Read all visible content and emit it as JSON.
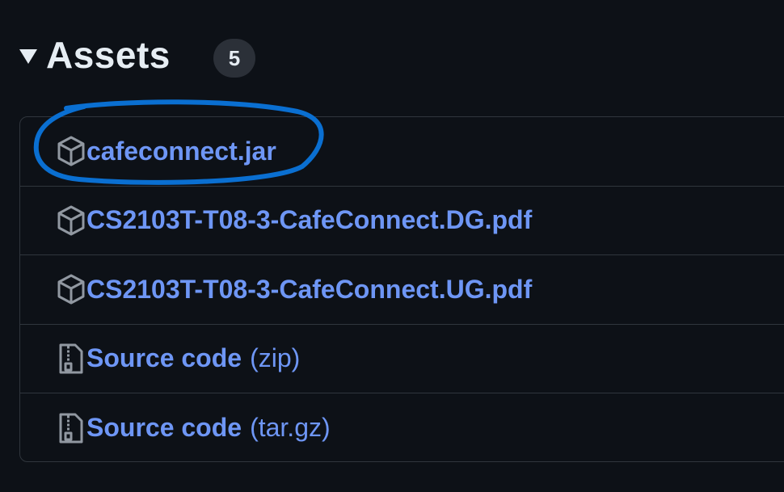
{
  "assets": {
    "title": "Assets",
    "count": "5",
    "items": [
      {
        "name": "cafeconnect.jar",
        "suffix": "",
        "icon": "package-icon"
      },
      {
        "name": "CS2103T-T08-3-CafeConnect.DG.pdf",
        "suffix": "",
        "icon": "package-icon"
      },
      {
        "name": "CS2103T-T08-3-CafeConnect.UG.pdf",
        "suffix": "",
        "icon": "package-icon"
      },
      {
        "name": "Source code",
        "suffix": "(zip)",
        "icon": "file-zip-icon"
      },
      {
        "name": "Source code",
        "suffix": "(tar.gz)",
        "icon": "file-zip-icon"
      }
    ]
  },
  "colors": {
    "background": "#0d1117",
    "link": "#6e96f5",
    "text": "#e6edf3",
    "border": "#30363d",
    "annotation": "#0a6fd1"
  }
}
